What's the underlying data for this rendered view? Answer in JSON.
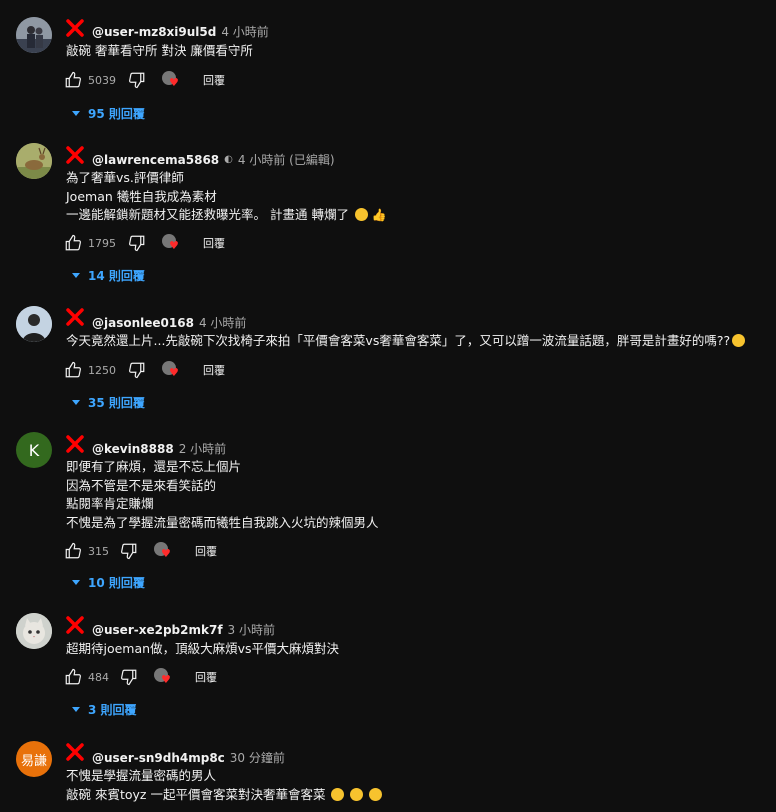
{
  "labels": {
    "reply": "回覆"
  },
  "colors": {
    "accent": "#3ea6ff",
    "heart": "#ff2b2b",
    "x_mark": "#ff0000"
  },
  "comments": [
    {
      "author": "@user-mz8xi9ul5d",
      "time": "4 小時前",
      "lines": [
        "敲碗 奢華看守所 對決 廉價看守所"
      ],
      "likes": "5039",
      "replies": "95 則回覆",
      "avatar_icon": "person-photo-avatar"
    },
    {
      "author": "@lawrencema5868",
      "time": "4 小時前 (已編輯)",
      "lines": [
        "為了奢華vs.評價律師",
        "Joeman 犧牲自我成為素材",
        "一邊能解鎖新題材又能拯救曝光率。 計畫通 轉爛了"
      ],
      "likes": "1795",
      "replies": "14 則回覆",
      "avatar_icon": "deer-photo-avatar"
    },
    {
      "author": "@jasonlee0168",
      "time": "4 小時前",
      "lines": [
        "今天竟然還上片...先敲碗下次找椅子來拍「平價會客菜vs奢華會客菜」了，又可以蹭一波流量話題，胖哥是計畫好的嗎??"
      ],
      "likes": "1250",
      "replies": "35 則回覆",
      "avatar_icon": "person-sky-avatar"
    },
    {
      "author": "@kevin8888",
      "time": "2 小時前",
      "lines": [
        "即便有了麻煩，還是不忘上個片",
        "因為不管是不是來看笑話的",
        "點閱率肯定賺爛",
        "不愧是為了學握流量密碼而犧牲自我跳入火坑的辣個男人"
      ],
      "likes": "315",
      "replies": "10 則回覆",
      "avatar_letter": "K"
    },
    {
      "author": "@user-xe2pb2mk7f",
      "time": "3 小時前",
      "lines": [
        "超期待joeman做，頂級大麻煩vs平價大麻煩對決"
      ],
      "likes": "484",
      "replies": "3 則回覆",
      "avatar_icon": "cat-photo-avatar"
    },
    {
      "author": "@user-sn9dh4mp8c",
      "time": "30 分鐘前",
      "lines": [
        "不愧是學握流量密碼的男人",
        "敲碗 來賓toyz 一起平價會客菜對決奢華會客菜"
      ],
      "avatar_letter": "易謙"
    }
  ]
}
